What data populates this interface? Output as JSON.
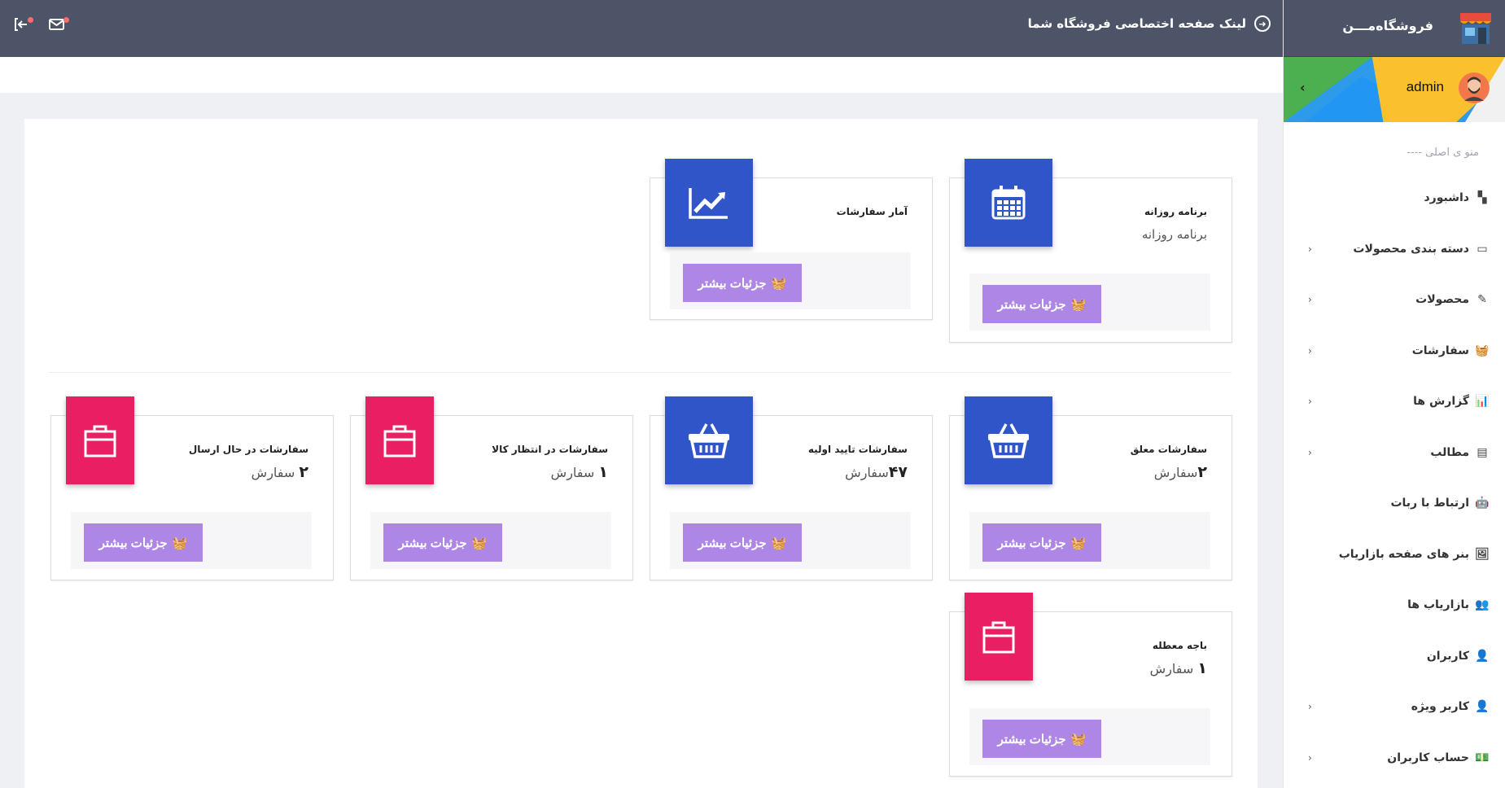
{
  "topbar": {
    "shop_link": "لینک صفحه اختصاصی فروشگاه شما"
  },
  "sidebar": {
    "brand": "فروشگاه‌مـــن",
    "username": "admin",
    "menu_header": "---- منو ی اصلی",
    "items": [
      {
        "label": "داشبورد",
        "icon": "dashboard-icon",
        "chevron": false
      },
      {
        "label": "دسته بندی محصولات",
        "icon": "folder-icon",
        "chevron": true
      },
      {
        "label": "محصولات",
        "icon": "edit-icon",
        "chevron": true
      },
      {
        "label": "سفارشات",
        "icon": "basket-icon",
        "chevron": true
      },
      {
        "label": "گزارش ها",
        "icon": "bar-chart-icon",
        "chevron": true
      },
      {
        "label": "مطالب",
        "icon": "calendar-icon",
        "chevron": true
      },
      {
        "label": "ارتباط با ربات",
        "icon": "android-icon",
        "chevron": false
      },
      {
        "label": "بنر های صفحه بازاریاب",
        "icon": "image-icon",
        "chevron": false
      },
      {
        "label": "بازاریاب ها",
        "icon": "users-icon",
        "chevron": false
      },
      {
        "label": "کاربران",
        "icon": "user-outline-icon",
        "chevron": false
      },
      {
        "label": "کاربر ویژه",
        "icon": "user-icon",
        "chevron": true
      },
      {
        "label": "حساب کاربران",
        "icon": "money-icon",
        "chevron": true
      }
    ]
  },
  "cards": {
    "daily": {
      "title": "برنامه روزانه",
      "subtitle": "برنامه روزانه",
      "button": "جزئیات بیشتر"
    },
    "stats": {
      "title": "آمار سفارشات",
      "button": "جزئیات بیشتر"
    },
    "pending": {
      "title": "سفارشات معلق",
      "count": "۲",
      "unit": "سفارش",
      "button": "جزئیات بیشتر"
    },
    "initial": {
      "title": "سفارشات تایید اولیه",
      "count": "۴۷",
      "unit": "سفارش",
      "button": "جزئیات بیشتر"
    },
    "awaiting": {
      "title": "سفارشات در انتظار کالا",
      "count": "۱",
      "unit": "سفارش",
      "button": "جزئیات بیشتر"
    },
    "shipping": {
      "title": "سفارشات در حال ارسال",
      "count": "۲",
      "unit": "سفارش",
      "button": "جزئیات بیشتر"
    },
    "stale": {
      "title": "باجه معطله",
      "count": "۱",
      "unit": "سفارش",
      "button": "جزئیات بیشتر"
    }
  },
  "colors": {
    "topbar": "#4e5468",
    "primary": "#2f55c9",
    "pink": "#e91e63",
    "button": "#ae87e6"
  }
}
